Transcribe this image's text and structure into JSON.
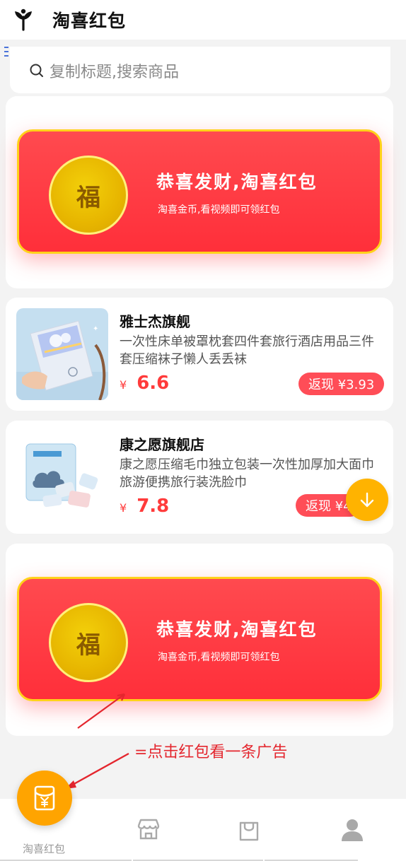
{
  "header": {
    "title": "淘喜红包"
  },
  "search": {
    "placeholder": "复制标题,搜索商品"
  },
  "banners": [
    {
      "coin_char": "福",
      "title": "恭喜发财,淘喜红包",
      "subtitle": "淘喜金币,看视频即可领红包"
    },
    {
      "coin_char": "福",
      "title": "恭喜发财,淘喜红包",
      "subtitle": "淘喜金币,看视频即可领红包"
    }
  ],
  "products": [
    {
      "shop": "雅士杰旗舰",
      "desc": "一次性床单被罩枕套四件套旅行酒店用品三件套压缩袜子懒人丢丢袜",
      "currency": "¥",
      "price": "6.6",
      "rebate": "返现 ¥3.93"
    },
    {
      "shop": "康之愿旗舰店",
      "desc": "康之愿压缩毛巾独立包装一次性加厚加大面巾旅游便携旅行装洗脸巾",
      "currency": "¥",
      "price": "7.8",
      "rebate": "返现 ¥4"
    }
  ],
  "annotation": "=点击红包看一条广告",
  "bottom_nav": {
    "items": [
      {
        "label": "淘喜红包",
        "icon": "red-envelope-icon"
      },
      {
        "label": "",
        "icon": "store-icon"
      },
      {
        "label": "",
        "icon": "shopping-bag-icon"
      },
      {
        "label": "",
        "icon": "user-icon"
      }
    ]
  },
  "colors": {
    "accent": "#ffa400",
    "banner_red": "#ff3a43",
    "price_red": "#ff3b3b",
    "coin_gold": "#e7b500"
  }
}
